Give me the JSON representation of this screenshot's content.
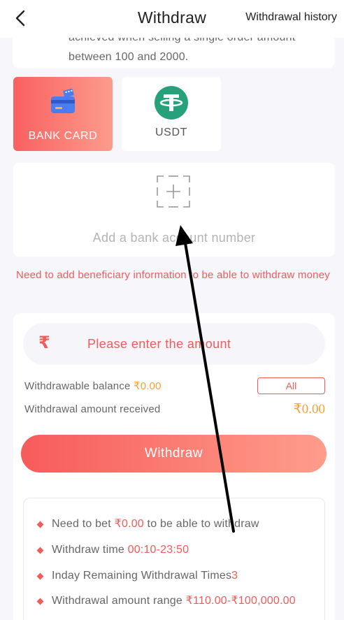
{
  "header": {
    "title": "Withdraw",
    "history_link": "Withdrawal history"
  },
  "notice": {
    "line1": "achieved when selling a single order amount",
    "line2": "between 100 and 2000."
  },
  "methods": [
    {
      "label": "BANK CARD",
      "icon": "bank-card-icon",
      "selected": true
    },
    {
      "label": "USDT",
      "icon": "usdt-tether-icon",
      "selected": false
    }
  ],
  "bank_account": {
    "add_label": "Add a bank account number"
  },
  "warning": "Need to add beneficiary information to be able to withdraw money",
  "amount": {
    "currency_symbol": "₹",
    "placeholder": "Please enter the amount",
    "value": ""
  },
  "balance": {
    "withdrawable_label": "Withdrawable balance ",
    "withdrawable_value": "₹0.00",
    "all_button": "All",
    "received_label": "Withdrawal amount received",
    "received_value": "₹0.00"
  },
  "withdraw_button": "Withdraw",
  "rules": {
    "bet_prefix": "Need to bet ",
    "bet_value": "₹0.00",
    "bet_suffix": " to be able to withdraw",
    "time_prefix": "Withdraw time ",
    "time_value": "00:10-23:50",
    "times_prefix": "Inday Remaining Withdrawal Times",
    "times_value": "3",
    "range_prefix": "Withdrawal amount range ",
    "range_value": "₹110.00-₹100,000.00"
  },
  "colors": {
    "accent": "#f25b5b",
    "gold": "#f0a23c",
    "usdt_green": "#26a17b",
    "bank_icon_blue": "#4a7df0"
  }
}
